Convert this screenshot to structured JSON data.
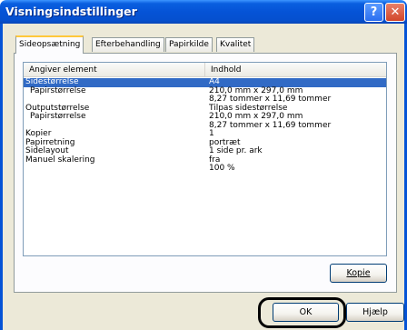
{
  "window": {
    "title": "Visningsindstillinger",
    "help_glyph": "?",
    "close_glyph": "✕"
  },
  "tabs": [
    {
      "label": "Sideopsætning",
      "active": true
    },
    {
      "label": "Efterbehandling",
      "active": false
    },
    {
      "label": "Papirkilde",
      "active": false
    },
    {
      "label": "Kvalitet",
      "active": false
    }
  ],
  "list": {
    "headers": {
      "col1": "Angiver element",
      "col2": "Indhold"
    },
    "rows": [
      {
        "c1": "Sidestørrelse",
        "c2": "A4",
        "selected": true,
        "indent": false
      },
      {
        "c1": "Papirstørrelse",
        "c2": "210,0 mm x 297,0 mm",
        "selected": false,
        "indent": true
      },
      {
        "c1": "",
        "c2": "8,27 tommer x 11,69 tommer",
        "selected": false,
        "indent": false
      },
      {
        "c1": "Outputstørrelse",
        "c2": "Tilpas sidestørrelse",
        "selected": false,
        "indent": false
      },
      {
        "c1": "Papirstørrelse",
        "c2": "210,0 mm x 297,0 mm",
        "selected": false,
        "indent": true
      },
      {
        "c1": "",
        "c2": "8,27 tommer x 11,69 tommer",
        "selected": false,
        "indent": false
      },
      {
        "c1": "Kopier",
        "c2": "1",
        "selected": false,
        "indent": false
      },
      {
        "c1": "Papirretning",
        "c2": "portræt",
        "selected": false,
        "indent": false
      },
      {
        "c1": "Sidelayout",
        "c2": "1 side pr. ark",
        "selected": false,
        "indent": false
      },
      {
        "c1": "Manuel skalering",
        "c2": "fra",
        "selected": false,
        "indent": false
      },
      {
        "c1": "",
        "c2": "100 %",
        "selected": false,
        "indent": false
      }
    ]
  },
  "buttons": {
    "kopie": "Kopie",
    "ok": "OK",
    "help": "Hjælp"
  },
  "colors": {
    "titlebar": "#0553d6",
    "selection": "#316ac5",
    "dialog_bg": "#ece9d8"
  }
}
